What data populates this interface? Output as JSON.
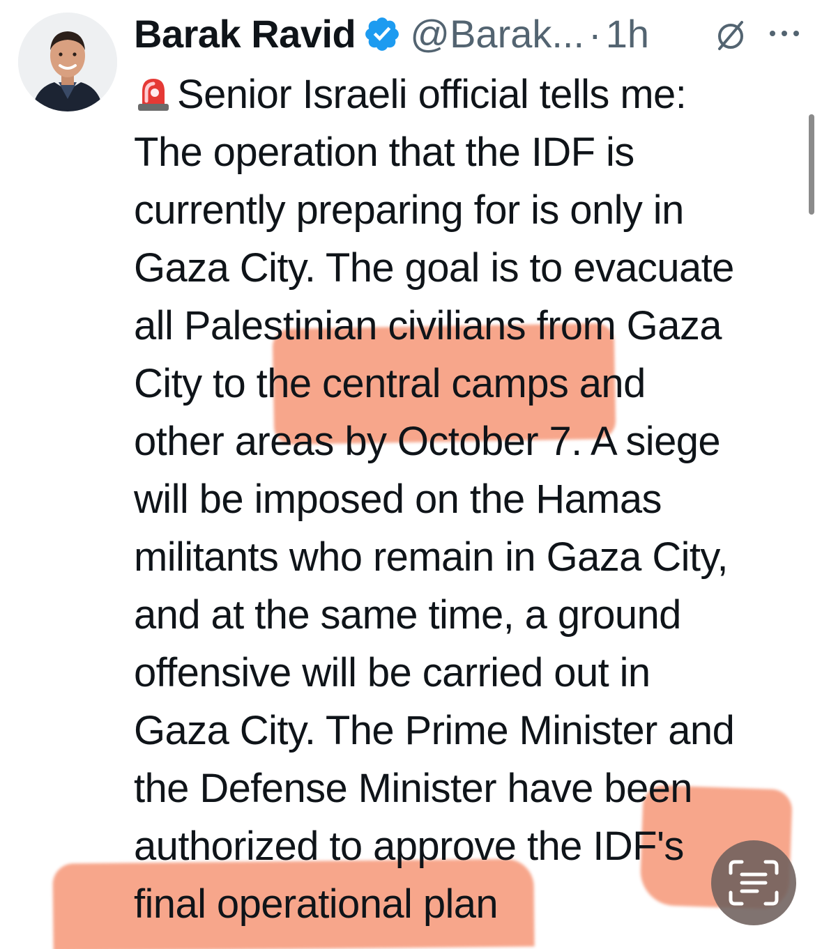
{
  "author": {
    "display_name": "Barak Ravid",
    "handle": "@Barak...",
    "separator": "·",
    "time": "1h",
    "verified": true
  },
  "colors": {
    "verified_badge": "#1d9bf0",
    "text_primary": "#0f1419",
    "text_secondary": "#536471",
    "highlight": "#f4845f"
  },
  "icons": {
    "siren": "siren-emoji-icon",
    "verified": "verified-badge-icon",
    "grok": "grok-icon",
    "more": "more-options-icon",
    "scan": "text-scan-icon"
  },
  "tweet": {
    "lines": [
      "Senior Israeli official tells me:",
      "The operation that the IDF is",
      "currently preparing for is only in",
      "Gaza City. The goal is to evacuate",
      "all Palestinian civilians from Gaza",
      "City to the central camps and",
      "other areas by October 7. A siege",
      "will be imposed on the Hamas",
      "militants who remain in Gaza City,",
      "and at the same time, a ground",
      "offensive will be carried out in",
      "Gaza City. The Prime Minister and",
      "the Defense Minister have been",
      "authorized to approve the IDF's",
      "final operational plan"
    ]
  }
}
